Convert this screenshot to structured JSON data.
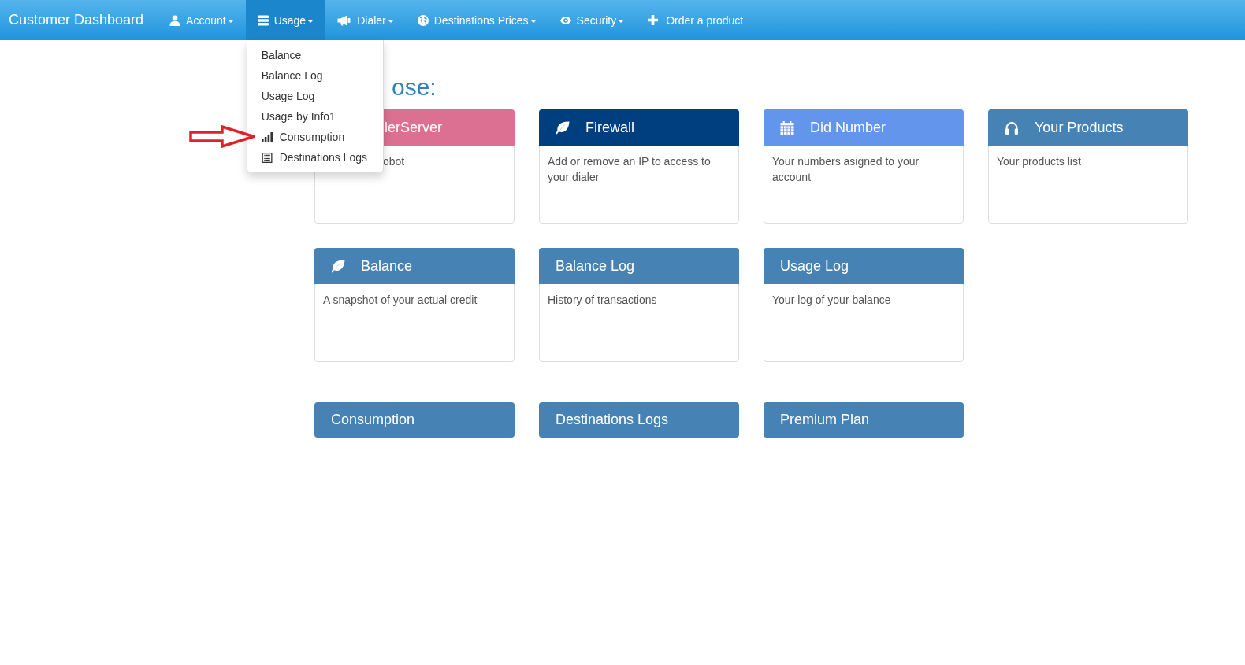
{
  "navbar": {
    "brand": "Customer Dashboard",
    "items": [
      {
        "label": "Account",
        "kind": "dropdown",
        "expanded": false
      },
      {
        "label": "Usage",
        "kind": "dropdown",
        "expanded": true,
        "menu": [
          {
            "label": "Balance",
            "highlighted": false
          },
          {
            "label": "Balance Log",
            "highlighted": false
          },
          {
            "label": "Usage Log",
            "highlighted": false
          },
          {
            "label": "Usage by Info1",
            "highlighted": false
          },
          {
            "label": "Consumption",
            "highlighted": true
          },
          {
            "label": "Destinations Logs",
            "highlighted": false
          }
        ]
      },
      {
        "label": "Dialer",
        "kind": "dropdown",
        "expanded": false
      },
      {
        "label": "Destinations Prices",
        "kind": "dropdown",
        "expanded": false
      },
      {
        "label": "Security",
        "kind": "dropdown",
        "expanded": false
      },
      {
        "label": "Order a product",
        "kind": "link",
        "expanded": false
      }
    ]
  },
  "heading": "ose:",
  "cards": [
    {
      "title": "lerServer",
      "text": "obot",
      "color": "#db7093"
    },
    {
      "title": "Firewall",
      "text": "Add or remove an IP to access to your dialer",
      "color": "#003f7f"
    },
    {
      "title": "Did Number",
      "text": "Your numbers asigned to your account",
      "color": "#6495ed"
    },
    {
      "title": "Your Products",
      "text": "Your products list",
      "color": "#4682b4"
    },
    {
      "title": "Balance",
      "text": "A snapshot of your actual credit",
      "color": "#4682b4"
    },
    {
      "title": "Balance Log",
      "text": "History of transactions",
      "color": "#4682b4"
    },
    {
      "title": "Usage Log",
      "text": "Your log of your balance",
      "color": "#4682b4"
    }
  ],
  "links": [
    {
      "title": "Consumption"
    },
    {
      "title": "Destinations Logs"
    },
    {
      "title": "Premium Plan"
    }
  ]
}
